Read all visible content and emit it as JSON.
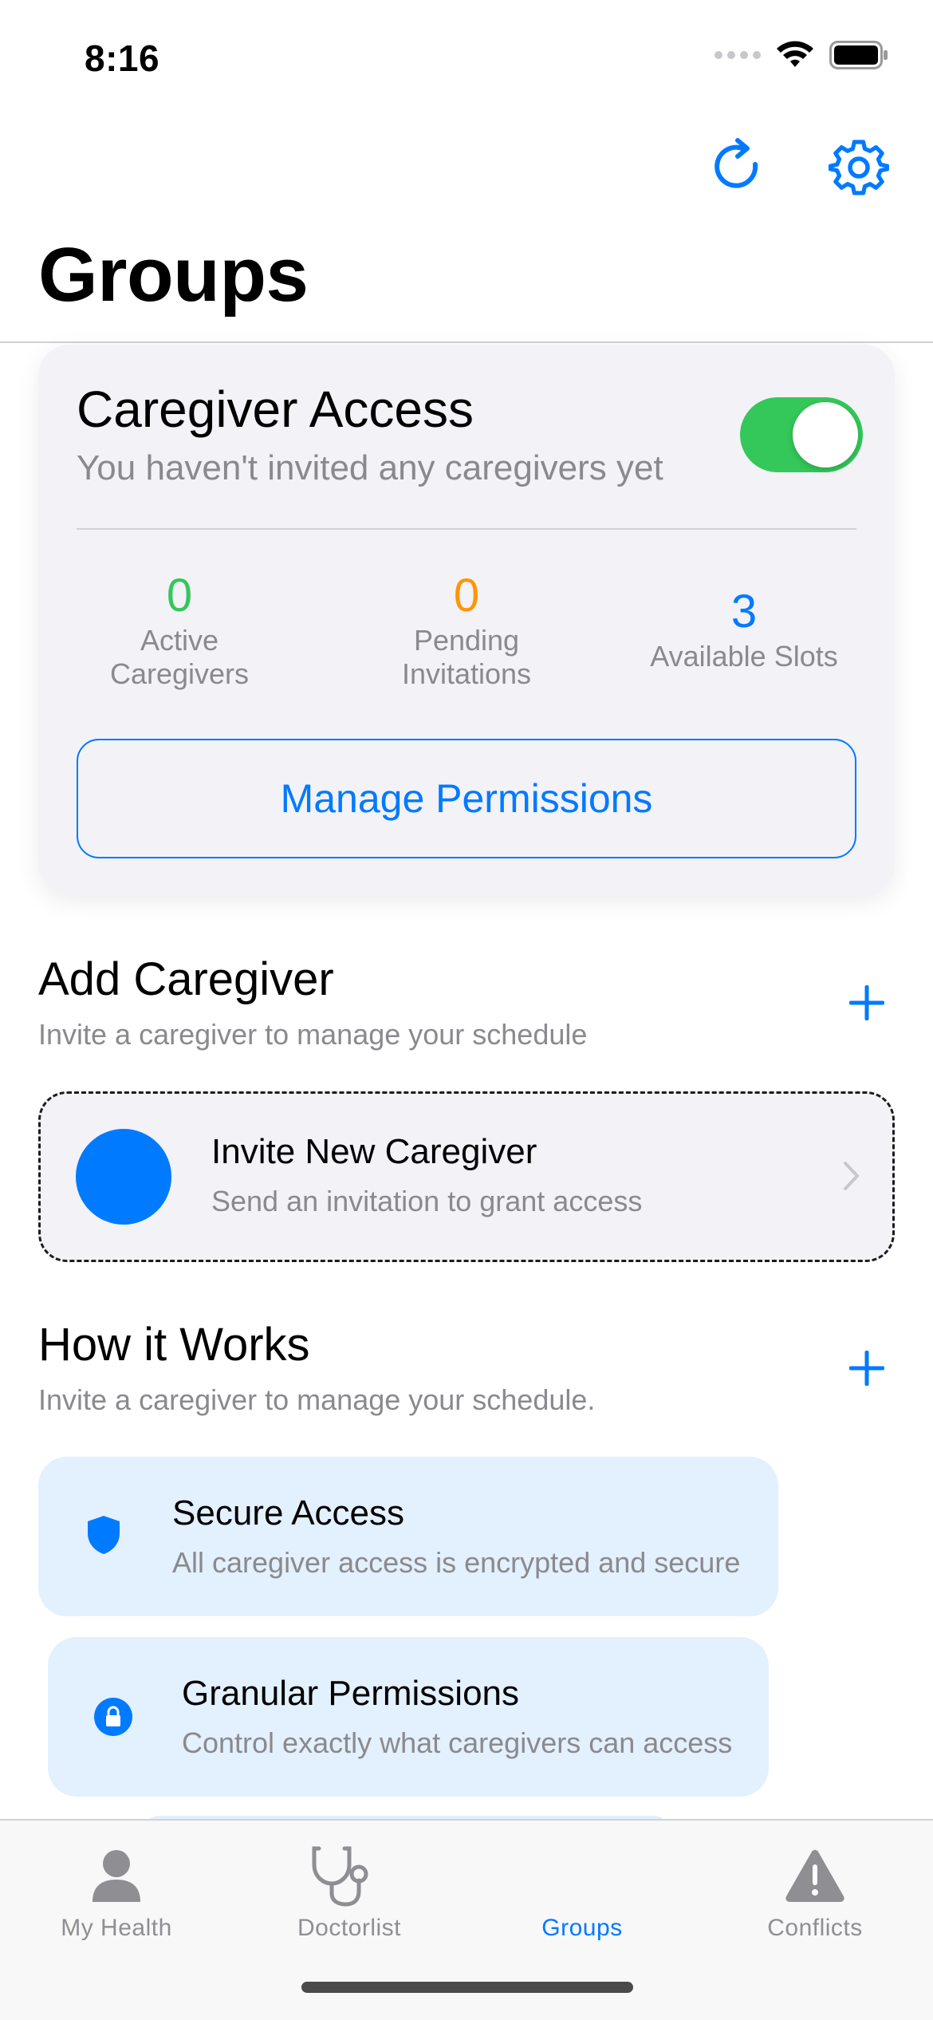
{
  "status_bar": {
    "time": "8:16"
  },
  "page": {
    "title": "Groups"
  },
  "access_card": {
    "title": "Caregiver Access",
    "subtitle": "You haven't invited any caregivers yet",
    "toggle_on": true,
    "stats": [
      {
        "value": "0",
        "label_line1": "Active",
        "label_line2": "Caregivers"
      },
      {
        "value": "0",
        "label_line1": "Pending",
        "label_line2": "Invitations"
      },
      {
        "value": "3",
        "label_line1": "Available Slots"
      }
    ],
    "manage_button": "Manage Permissions"
  },
  "add_section": {
    "title": "Add Caregiver",
    "subtitle": "Invite a caregiver to manage your schedule",
    "invite": {
      "title": "Invite New Caregiver",
      "subtitle": "Send an invitation to grant access"
    }
  },
  "how_section": {
    "title": "How it Works",
    "subtitle": "Invite a caregiver to manage your schedule.",
    "items": [
      {
        "icon": "shield-icon",
        "title": "Secure Access",
        "subtitle": "All caregiver access is encrypted and secure"
      },
      {
        "icon": "lock-icon",
        "title": "Granular Permissions",
        "subtitle": "Control exactly what caregivers can access"
      }
    ]
  },
  "tab_bar": {
    "tabs": [
      {
        "label": "My Health",
        "icon": "person-icon",
        "active": false
      },
      {
        "label": "Doctorlist",
        "icon": "stethoscope-icon",
        "active": false
      },
      {
        "label": "Groups",
        "icon": "groups-icon",
        "active": true
      },
      {
        "label": "Conflicts",
        "icon": "warning-icon",
        "active": false
      }
    ]
  },
  "colors": {
    "accent": "#007aff",
    "green": "#34c759",
    "orange": "#ff9500",
    "card_bg": "#f2f2f7",
    "info_bg": "#e3f0fd"
  }
}
